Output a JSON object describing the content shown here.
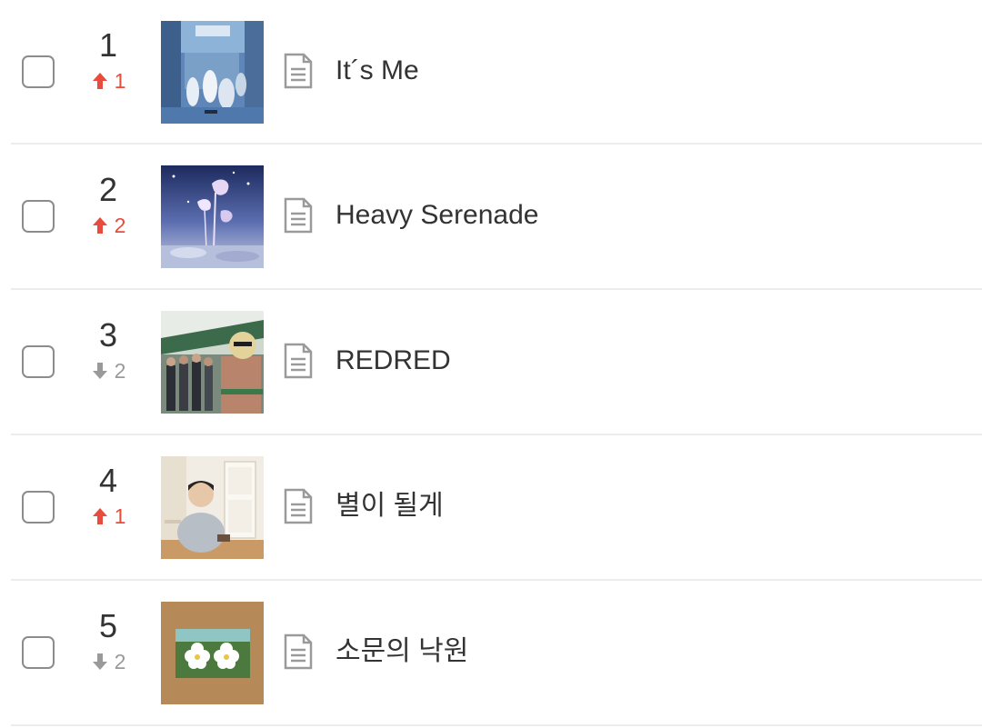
{
  "chart": {
    "rows": [
      {
        "rank": "1",
        "change_direction": "up",
        "change_icon": "arrow-up-icon",
        "change_value": "1",
        "title": "It´s Me",
        "art_theme": "street-blue",
        "change_color": "#e74c3c"
      },
      {
        "rank": "2",
        "change_direction": "up",
        "change_icon": "arrow-up-icon",
        "change_value": "2",
        "title": "Heavy Serenade",
        "art_theme": "night-flowers",
        "change_color": "#e74c3c"
      },
      {
        "rank": "3",
        "change_direction": "down",
        "change_icon": "arrow-down-icon",
        "change_value": "2",
        "title": "REDRED",
        "art_theme": "group-bridge",
        "change_color": "#9a9a9a"
      },
      {
        "rank": "4",
        "change_direction": "up",
        "change_icon": "arrow-up-icon",
        "change_value": "1",
        "title": "별이 될게",
        "art_theme": "bright-room",
        "change_color": "#e74c3c"
      },
      {
        "rank": "5",
        "change_direction": "down",
        "change_icon": "arrow-down-icon",
        "change_value": "2",
        "title": "소문의 낙원",
        "art_theme": "cardboard-flowers",
        "change_color": "#9a9a9a"
      }
    ]
  },
  "icons": {
    "checkbox": "checkbox-icon",
    "lyrics": "document-icon"
  }
}
